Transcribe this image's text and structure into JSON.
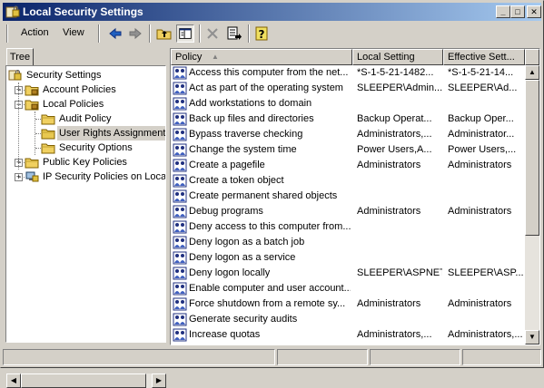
{
  "window": {
    "title": "Local Security Settings"
  },
  "titlebar_buttons": {
    "minimize": "_",
    "maximize": "□",
    "close": "✕"
  },
  "menu": {
    "action": "Action",
    "view": "View"
  },
  "tree": {
    "tab": "Tree",
    "nodes": [
      {
        "label": "Security Settings",
        "level": 0
      },
      {
        "label": "Account Policies",
        "level": 1,
        "expander": "+"
      },
      {
        "label": "Local Policies",
        "level": 1,
        "expander": "−"
      },
      {
        "label": "Audit Policy",
        "level": 2
      },
      {
        "label": "User Rights Assignment",
        "level": 2,
        "selected": true
      },
      {
        "label": "Security Options",
        "level": 2
      },
      {
        "label": "Public Key Policies",
        "level": 1,
        "expander": "+"
      },
      {
        "label": "IP Security Policies on Local",
        "level": 1,
        "expander": "+"
      }
    ]
  },
  "list": {
    "columns": [
      "Policy",
      "Local Setting",
      "Effective Sett..."
    ],
    "sort_glyph": "▲",
    "rows": [
      [
        "Access this computer from the net...",
        "*S-1-5-21-1482...",
        "*S-1-5-21-14..."
      ],
      [
        "Act as part of the operating system",
        "SLEEPER\\Admin...",
        "SLEEPER\\Ad..."
      ],
      [
        "Add workstations to domain",
        "",
        ""
      ],
      [
        "Back up files and directories",
        "Backup Operat...",
        "Backup Oper..."
      ],
      [
        "Bypass traverse checking",
        "Administrators,...",
        "Administrator..."
      ],
      [
        "Change the system time",
        "Power Users,A...",
        "Power Users,..."
      ],
      [
        "Create a pagefile",
        "Administrators",
        "Administrators"
      ],
      [
        "Create a token object",
        "",
        ""
      ],
      [
        "Create permanent shared objects",
        "",
        ""
      ],
      [
        "Debug programs",
        "Administrators",
        "Administrators"
      ],
      [
        "Deny access to this computer from...",
        "",
        ""
      ],
      [
        "Deny logon as a batch job",
        "",
        ""
      ],
      [
        "Deny logon as a service",
        "",
        ""
      ],
      [
        "Deny logon locally",
        "SLEEPER\\ASPNET",
        "SLEEPER\\ASP..."
      ],
      [
        "Enable computer and user account...",
        "",
        ""
      ],
      [
        "Force shutdown from a remote sy...",
        "Administrators",
        "Administrators"
      ],
      [
        "Generate security audits",
        "",
        ""
      ],
      [
        "Increase quotas",
        "Administrators,...",
        "Administrators,..."
      ]
    ]
  },
  "icons": {
    "title": "security-settings-icon",
    "toolbar": [
      "back-arrow-icon",
      "forward-arrow-icon",
      "up-folder-icon",
      "show-hide-tree-icon",
      "delete-icon",
      "export-list-icon",
      "help-icon"
    ]
  },
  "colors": {
    "title_start": "#0a246a",
    "title_end": "#a6caf0",
    "face": "#d4d0c8",
    "folder": "#f0d060"
  }
}
